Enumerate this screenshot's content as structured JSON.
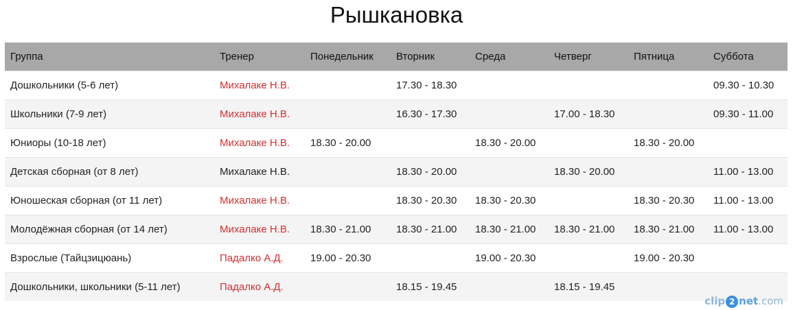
{
  "page_title": "Рышкановка",
  "table": {
    "headers": [
      "Группа",
      "Тренер",
      "Понедельник",
      "Вторник",
      "Среда",
      "Четверг",
      "Пятница",
      "Суббота"
    ],
    "rows": [
      {
        "group": "Дошкольники (5-6 лет)",
        "coach": "Михалаке Н.В.",
        "coach_link": true,
        "mon": "",
        "tue": "17.30 - 18.30",
        "wed": "",
        "thu": "",
        "fri": "",
        "sat": "09.30 - 10.30"
      },
      {
        "group": "Школьники (7-9 лет)",
        "coach": "Михалаке Н.В.",
        "coach_link": true,
        "mon": "",
        "tue": "16.30 - 17.30",
        "wed": "",
        "thu": "17.00 - 18.30",
        "fri": "",
        "sat": "09.30 - 11.00"
      },
      {
        "group": "Юниоры (10-18 лет)",
        "coach": "Михалаке Н.В.",
        "coach_link": true,
        "mon": "18.30 - 20.00",
        "tue": "",
        "wed": "18.30 - 20.00",
        "thu": "",
        "fri": "18.30 - 20.00",
        "sat": ""
      },
      {
        "group": "Детская сборная (от 8 лет)",
        "coach": "Михалаке Н.В.",
        "coach_link": false,
        "mon": "",
        "tue": "18.30 - 20.00",
        "wed": "",
        "thu": "18.30 - 20.00",
        "fri": "",
        "sat": "11.00 - 13.00"
      },
      {
        "group": "Юношеская сборная (от 11 лет)",
        "coach": "Михалаке Н.В.",
        "coach_link": true,
        "mon": "",
        "tue": "18.30 - 20.30",
        "wed": "18.30 - 20.30",
        "thu": "",
        "fri": "18.30 - 20.30",
        "sat": "11.00 - 13.00"
      },
      {
        "group": "Молодёжная сборная (от 14 лет)",
        "coach": "Михалаке Н.В.",
        "coach_link": true,
        "mon": "18.30 - 21.00",
        "tue": "18.30 - 21.00",
        "wed": "18.30 - 21.00",
        "thu": "18.30 - 21.00",
        "fri": "18.30 - 21.00",
        "sat": "11.00 - 13.00"
      },
      {
        "group": "Взрослые (Тайцзицюань)",
        "coach": "Падалко А.Д.",
        "coach_link": true,
        "mon": "19.00 - 20.30",
        "tue": "",
        "wed": "19.00 - 20.30",
        "thu": "",
        "fri": "19.00 - 20.30",
        "sat": ""
      },
      {
        "group": "Дошкольники, школьники (5-11 лет)",
        "coach": "Падалко А.Д.",
        "coach_link": true,
        "mon": "",
        "tue": "18.15 - 19.45",
        "wed": "",
        "thu": "18.15 - 19.45",
        "fri": "",
        "sat": ""
      }
    ]
  },
  "colors": {
    "header_bg": "#a8a8a8",
    "link": "#d32f2f",
    "row_alt": "#f4f4f4"
  },
  "watermark": {
    "part1": "clip",
    "digit": "2",
    "part2": "net",
    "part3": ".com"
  }
}
